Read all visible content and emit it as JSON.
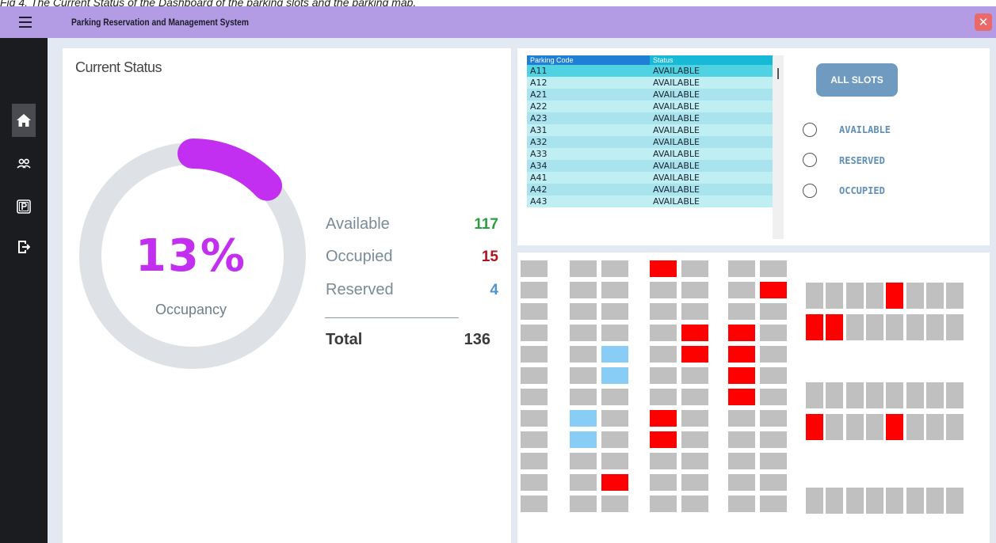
{
  "caption": "Fig 4. The Current Status of the Dashboard of the parking slots and the parking map.",
  "window": {
    "title": "Parking Reservation and Management System",
    "close_glyph": "✕"
  },
  "sidebar": {
    "items": [
      {
        "name": "home",
        "icon": "home-icon",
        "active": true
      },
      {
        "name": "users",
        "icon": "users-icon",
        "active": false
      },
      {
        "name": "parking",
        "icon": "parking-icon",
        "active": false
      },
      {
        "name": "logout",
        "icon": "logout-icon",
        "active": false
      }
    ]
  },
  "status": {
    "title": "Current Status",
    "occupancy_percent": "13%",
    "occupancy_fraction": 0.13,
    "occupancy_label": "Occupancy",
    "available_label": "Available",
    "available_value": "117",
    "occupied_label": "Occupied",
    "occupied_value": "15",
    "reserved_label": "Reserved",
    "reserved_value": "4",
    "total_label": "Total",
    "total_value": "136"
  },
  "colors": {
    "accent_purple": "#c22ff0",
    "ring_track": "#dee1e6",
    "available": "#2a9f3e",
    "occupied": "#b0141c",
    "reserved": "#4f95cc",
    "slot_free": "#c0c0c0",
    "slot_occupied": "#ff0000",
    "slot_reserved": "#88cdf6"
  },
  "slot_list": {
    "header_code": "Parking Code",
    "header_status": "Status",
    "rows": [
      {
        "code": "A11",
        "status": "AVAILABLE"
      },
      {
        "code": "A12",
        "status": "AVAILABLE"
      },
      {
        "code": "A21",
        "status": "AVAILABLE"
      },
      {
        "code": "A22",
        "status": "AVAILABLE"
      },
      {
        "code": "A23",
        "status": "AVAILABLE"
      },
      {
        "code": "A31",
        "status": "AVAILABLE"
      },
      {
        "code": "A32",
        "status": "AVAILABLE"
      },
      {
        "code": "A33",
        "status": "AVAILABLE"
      },
      {
        "code": "A34",
        "status": "AVAILABLE"
      },
      {
        "code": "A41",
        "status": "AVAILABLE"
      },
      {
        "code": "A42",
        "status": "AVAILABLE"
      },
      {
        "code": "A43",
        "status": "AVAILABLE"
      }
    ]
  },
  "filters": {
    "all_slots_label": "ALL SLOTS",
    "options": [
      {
        "label": "AVAILABLE"
      },
      {
        "label": "RESERVED"
      },
      {
        "label": "OCCUPIED"
      }
    ]
  },
  "parking_map": {
    "left_block": {
      "rows": 12,
      "occupied": [
        [
          0,
          3
        ],
        [
          1,
          6
        ],
        [
          3,
          4
        ],
        [
          3,
          5
        ],
        [
          4,
          4
        ],
        [
          4,
          5
        ],
        [
          5,
          5
        ],
        [
          6,
          5
        ],
        [
          7,
          3
        ],
        [
          8,
          3
        ],
        [
          10,
          2
        ]
      ],
      "reserved": [
        [
          4,
          2
        ],
        [
          5,
          2
        ],
        [
          7,
          1
        ],
        [
          8,
          1
        ]
      ]
    },
    "right_block": {
      "rows": [
        {
          "occupied": [
            4
          ]
        },
        {
          "occupied": [
            0,
            1
          ]
        },
        {
          "occupied": []
        },
        {
          "occupied": [
            0,
            4
          ]
        },
        {
          "occupied": []
        }
      ]
    }
  }
}
